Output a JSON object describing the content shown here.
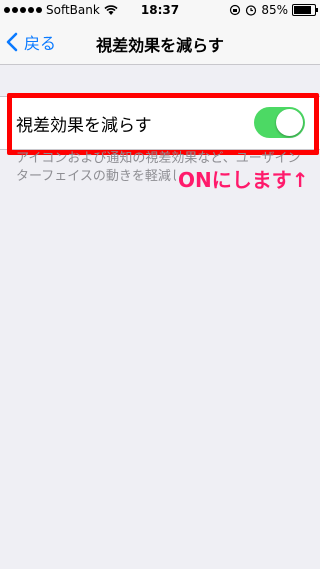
{
  "status_bar": {
    "carrier": "SoftBank",
    "time": "18:37",
    "battery": "85%",
    "battery_level": 0.85,
    "signal_dots": 5
  },
  "nav": {
    "back_label": "戻る",
    "title": "視差効果を減らす"
  },
  "setting": {
    "label": "視差効果を減らす",
    "toggle_on": true,
    "toggle_color": "#4cd964"
  },
  "footer": {
    "text": "アイコンおよび通知の視差効果など、ユーザインターフェイスの動きを軽減します。"
  },
  "annotation": {
    "text": "ONにします↑",
    "color": "#ff1a6b",
    "highlight_color": "#ff0000"
  },
  "colors": {
    "accent": "#0a7aff",
    "background": "#efeff4"
  }
}
